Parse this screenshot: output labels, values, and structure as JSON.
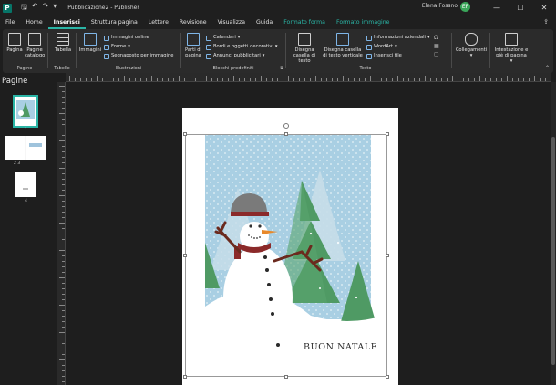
{
  "titlebar": {
    "app_icon": "P",
    "doc_title": "Pubblicazione2 - Publisher",
    "user_name": "Elena Fossno",
    "user_initial": "EF",
    "minimize": "—",
    "maximize": "☐",
    "close": "✕"
  },
  "tabs": [
    {
      "label": "File"
    },
    {
      "label": "Home"
    },
    {
      "label": "Inserisci"
    },
    {
      "label": "Struttura pagina"
    },
    {
      "label": "Lettere"
    },
    {
      "label": "Revisione"
    },
    {
      "label": "Visualizza"
    },
    {
      "label": "Guida"
    },
    {
      "label": "Formato forma"
    },
    {
      "label": "Formato immagine"
    }
  ],
  "ribbon": {
    "pagine": {
      "btn1": "Pagina",
      "btn2": "Pagine catalogo",
      "group": "Pagine"
    },
    "tabelle": {
      "btn": "Tabella",
      "group": "Tabelle"
    },
    "illustrazioni": {
      "big": "Immagini",
      "s1": "Immagini online",
      "s2": "Forme",
      "s3": "Segnaposto per immagine",
      "group": "Illustrazioni"
    },
    "blocchi": {
      "big": "Parti di pagina",
      "s1": "Calendari",
      "s2": "Bordi e oggetti decorativi",
      "s3": "Annunci pubblicitari",
      "group": "Blocchi predefiniti"
    },
    "testo": {
      "b1": "Disegna casella di testo",
      "b2": "Disegna casella di testo verticale",
      "s1": "Informazioni aziendali",
      "s2": "WordArt",
      "s3": "Inserisci file",
      "group": "Testo"
    },
    "collegamenti": {
      "big": "Collegamenti"
    },
    "intestazione": {
      "big": "Intestazione e piè di pagina"
    }
  },
  "pages_panel": {
    "title": "Pagine",
    "thumb1": "1",
    "thumb23": "2    3",
    "thumb4": "4"
  },
  "card": {
    "caption": "BUON NATALE"
  },
  "colors": {
    "accent": "#2ab5a6",
    "sky": "#a9cfe3",
    "tree": "#4f9a64",
    "hat": "#7a7a7a",
    "scarf": "#8b2a2a",
    "nose": "#e8892b"
  }
}
